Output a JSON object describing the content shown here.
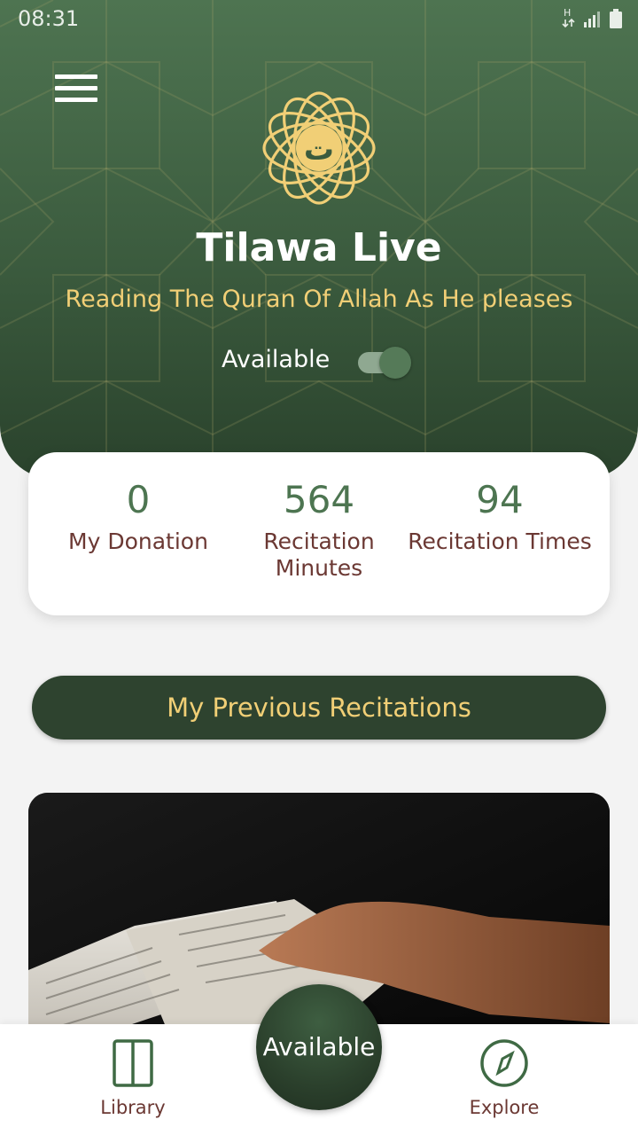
{
  "status_bar": {
    "time": "08:31",
    "network_label": "H",
    "icons": [
      "network-arrows-icon",
      "signal-icon",
      "battery-icon"
    ]
  },
  "header": {
    "title": "Tilawa Live",
    "subtitle": "Reading The Quran Of Allah As He pleases",
    "logo_icon": "tilawa-logo-icon",
    "logo_glyph": "ت",
    "availability_label": "Available",
    "availability_on": true
  },
  "stats": [
    {
      "value": "0",
      "label": "My Donation"
    },
    {
      "value": "564",
      "label": "Recitation Minutes"
    },
    {
      "value": "94",
      "label": "Recitation Times"
    }
  ],
  "previous_recitations_label": "My Previous Recitations",
  "banner": {
    "icon": "quran-reading-photo"
  },
  "bottom_nav": {
    "library_label": "Library",
    "center_label": "Available",
    "explore_label": "Explore"
  },
  "colors": {
    "header_green": "#3b5b3e",
    "accent_gold": "#f1cf76",
    "stat_green": "#4d7551",
    "label_brown": "#6b3833",
    "button_dark_green": "#2e432f"
  }
}
